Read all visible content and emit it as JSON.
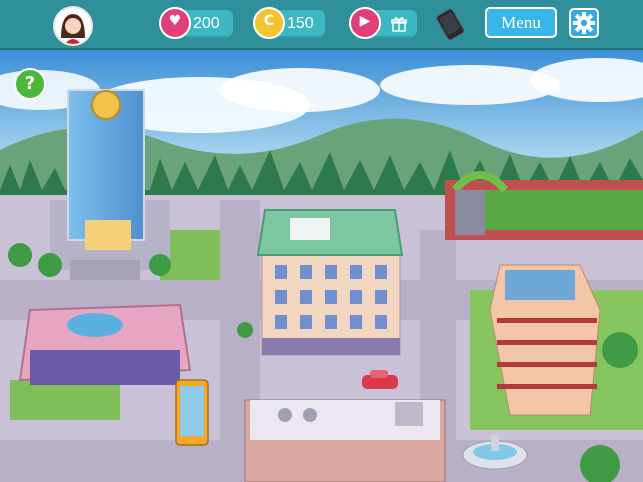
{
  "hud": {
    "avatar_icon": "girl-avatar-icon",
    "hearts": {
      "icon": "heart-coin-icon",
      "value": "200"
    },
    "coins": {
      "icon": "gold-coin-icon",
      "value": "150"
    },
    "video_reward": {
      "icon": "play-video-icon",
      "gift_icon": "gift-icon"
    },
    "phone_icon": "smartphone-icon",
    "menu_label": "Menu",
    "settings_icon": "gear-icon",
    "help_label": "?"
  },
  "colors": {
    "hud_bar": "#2f8f9b",
    "pill": "#3db8c2",
    "pink_currency": "#e0407a",
    "gold_currency": "#f0c530",
    "menu_button": "#38b6e8",
    "help_button": "#4cb83a"
  },
  "map": {
    "locations": [
      "headquarters-tower",
      "pink-studio",
      "central-apartment-building",
      "garden-park",
      "hotel-building",
      "fountain",
      "lower-shop-building",
      "yellow-bus",
      "red-car"
    ]
  }
}
